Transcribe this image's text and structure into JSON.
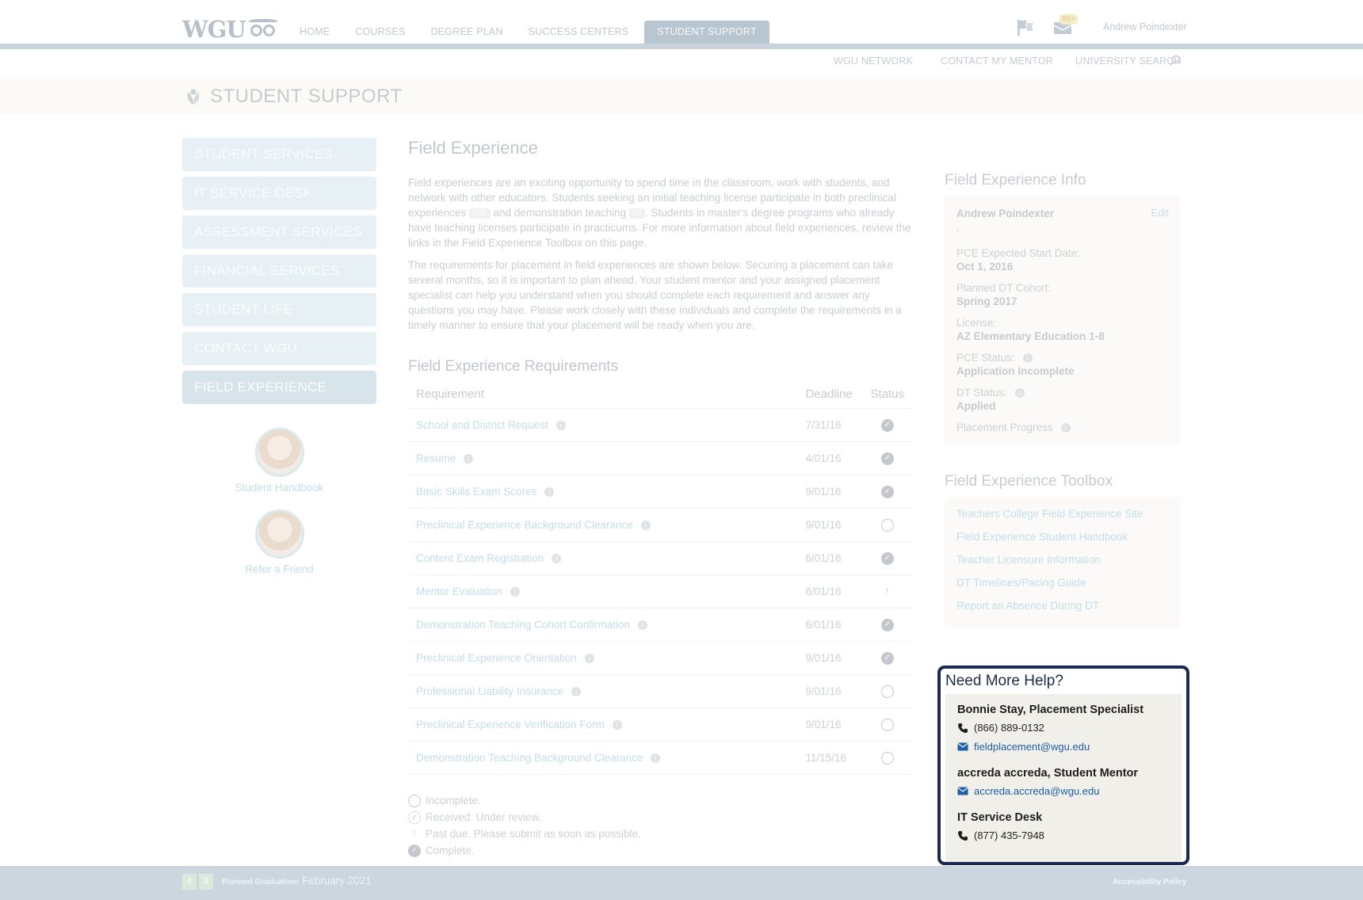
{
  "brand": {
    "logo_text": "WGU"
  },
  "nav": {
    "items": [
      "HOME",
      "COURSES",
      "DEGREE PLAN",
      "SUCCESS CENTERS",
      "STUDENT SUPPORT"
    ],
    "active": "STUDENT SUPPORT",
    "notifications_badge": "99+",
    "user_name": "Andrew Poindexter"
  },
  "subnav": {
    "network": "WGU NETWORK",
    "contact_mentor": "CONTACT MY MENTOR",
    "search": "UNIVERSITY SEARCH"
  },
  "banner": {
    "title": "STUDENT SUPPORT"
  },
  "sidebar": {
    "items": [
      {
        "label": "STUDENT SERVICES"
      },
      {
        "label": "IT SERVICE DESK"
      },
      {
        "label": "ASSESSMENT SERVICES"
      },
      {
        "label": "FINANCIAL SERVICES"
      },
      {
        "label": "STUDENT LIFE"
      },
      {
        "label": "CONTACT WGU"
      },
      {
        "label": "FIELD EXPERIENCE"
      }
    ],
    "active": "FIELD EXPERIENCE",
    "links": [
      {
        "label": "Student Handbook"
      },
      {
        "label": "Refer a Friend"
      }
    ]
  },
  "main": {
    "title": "Field Experience",
    "para1": {
      "a": "Field experiences are an exciting opportunity to spend time in the classroom, work with students, and network with other educators. Students seeking an initial teaching license participate in both preclinical experiences",
      "tag1": "PCE",
      "b": "and demonstration teaching",
      "tag2": "DT",
      "c": ". Students in master's degree programs who already have teaching licenses participate in practicums. For more information about field experiences, review the links in the Field Experience Toolbox on this page."
    },
    "para2": "The requirements for placement in field experiences are shown below. Securing a placement can take several months, so it is important to plan ahead. Your student mentor and your assigned placement specialist can help you understand when you should complete each requirement and answer any questions you may have. Please work closely with these individuals and complete the requirements in a timely manner to ensure that your placement will be ready when you are.",
    "requirements_title": "Field Experience Requirements",
    "table": {
      "headers": {
        "requirement": "Requirement",
        "deadline": "Deadline",
        "status": "Status"
      },
      "rows": [
        {
          "name": "School and District Request",
          "deadline": "7/31/16",
          "status": "complete"
        },
        {
          "name": "Resume",
          "deadline": "4/01/16",
          "status": "complete"
        },
        {
          "name": "Basic Skills Exam Scores",
          "deadline": "9/01/16",
          "status": "complete"
        },
        {
          "name": "Preclinical Experience Background Clearance",
          "deadline": "9/01/16",
          "status": "incomplete"
        },
        {
          "name": "Content Exam Registration",
          "deadline": "6/01/16",
          "status": "complete"
        },
        {
          "name": "Mentor Evaluation",
          "deadline": "6/01/16",
          "status": "past-due"
        },
        {
          "name": "Demonstration Teaching Cohort Confirmation",
          "deadline": "6/01/16",
          "status": "complete"
        },
        {
          "name": "Preclinical Experience Orientation",
          "deadline": "9/01/16",
          "status": "complete"
        },
        {
          "name": "Professional Liability Insurance",
          "deadline": "9/01/16",
          "status": "incomplete"
        },
        {
          "name": "Preclinical Experience Verification Form",
          "deadline": "9/01/16",
          "status": "incomplete"
        },
        {
          "name": "Demonstration Teaching Background Clearance",
          "deadline": "11/15/16",
          "status": "incomplete"
        }
      ]
    },
    "legend": [
      {
        "status": "incomplete",
        "label": "Incomplete."
      },
      {
        "status": "received",
        "label": "Received. Under review."
      },
      {
        "status": "past-due",
        "label": "Past due. Please submit as soon as possible."
      },
      {
        "status": "complete",
        "label": "Complete."
      }
    ]
  },
  "info": {
    "title": "Field Experience Info",
    "name": "Andrew Poindexter",
    "edit_label": "Edit",
    "comma": ",",
    "fields": {
      "pce_start": {
        "label": "PCE Expected Start Date:",
        "value": "Oct 1, 2016"
      },
      "dt_cohort": {
        "label": "Planned DT Cohort:",
        "value": "Spring 2017"
      },
      "license": {
        "label": "License:",
        "value": "AZ Elementary Education 1-8"
      },
      "pce_status": {
        "label": "PCE Status:",
        "value": "Application Incomplete"
      },
      "dt_status": {
        "label": "DT Status:",
        "value": "Applied"
      },
      "placement_progress": {
        "label": "Placement Progress"
      }
    }
  },
  "toolbox": {
    "title": "Field Experience Toolbox",
    "links": [
      "Teachers College Field Experience Site",
      "Field Experience Student Handbook",
      "Teacher Licensure Information",
      "DT Timelines/Pacing Guide",
      "Report an Absence During DT"
    ]
  },
  "help": {
    "title": "Need More Help?",
    "contacts": [
      {
        "name": "Bonnie Stay, Placement Specialist",
        "phone": "(866) 889-0132",
        "email": "fieldplacement@wgu.edu"
      },
      {
        "name": "accreda accreda, Student Mentor",
        "email": "accreda.accreda@wgu.edu"
      },
      {
        "name": "IT Service Desk",
        "phone": "(877) 435-7948"
      }
    ]
  },
  "footer": {
    "pills": [
      "4",
      "3"
    ],
    "planned_graduation_label": "Planned Graduation:",
    "planned_graduation_date": "February 2021",
    "accessibility": "Accessibility Policy"
  },
  "colors": {
    "focus_border": "#1b2a4e",
    "link": "#1d5ea8",
    "nav_active": "#b8c6d2",
    "footer_bg": "#ccd6df"
  }
}
